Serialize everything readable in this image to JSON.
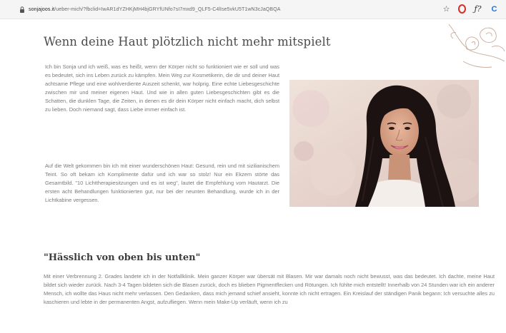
{
  "browser": {
    "url_domain": "sonjajoos.it",
    "url_path": "/ueber-mich/?fbclid=IwAR1dYZHKjMH4bjGRYfUNfo7sI7mxd9_QLF5-C4lIse5vkU5T1wN3cJaQBQA",
    "toolbar_icons": [
      "star-icon",
      "opera-icon",
      "fx-icon",
      "extension-icon"
    ]
  },
  "main": {
    "heading": "Wenn deine Haut plötzlich nicht mehr mitspielt",
    "paragraph1": "Ich bin Sonja und ich weiß, was es heißt, wenn der Körper nicht so funktioniert wie er soll und was es bedeutet, sich ins Leben zurück zu kämpfen. Mein Weg zur Kosmetikerin, die dir und deiner Haut achtsame Pflege und eine wohlverdiente Auszeit schenkt, war holprig. Eine echte Liebesgeschichte zwischen mir und meiner eigenen Haut. Und wie in allen guten Liebesgeschichten gibt es die Schatten, die dunklen Tage, die Zeiten, in denen es dir dein Körper nicht einfach macht, dich selbst zu lieben. Doch niemand sagt, dass Liebe immer einfach ist.",
    "paragraph2": "Auf die Welt gekommen bin ich mit einer wunderschönen Haut: Gesund, rein und mit sizilianischem Teint. So oft bekam ich Komplimente dafür und ich war so stolz! Nur ein Ekzem störte das Gesamtbild. \"10 Lichttherapiesitzungen und es ist weg\", lautet die Empfehlung vom Hautarzt. Die ersten acht Behandlungen funktionierten gut, nur bei der neunten Behandlung, wurde ich in der Lichtkabine vergessen.",
    "subheading": "\"Hässlich von oben bis unten\"",
    "paragraph3": "Mit einer Verbrennung 2. Grades landete ich in der Notfallklinik. Mein ganzer Körper war übersät mit Blasen. Mir war damals noch nicht bewusst, was das bedeutet. Ich dachte, meine Haut bildet sich wieder zurück. Nach 3-4 Tagen bildeten sich die Blasen zurück, doch es blieben Pigmentflecken und Rötungen. Ich fühlte mich entstellt! Innerhalb von 24 Stunden war ich ein anderer Mensch, ich wollte das Haus nicht mehr verlassen. Den Gedanken, dass mich jemand schief ansieht, konnte ich nicht ertragen. Ein Kreislauf der ständigen Panik begann: Ich versuchte alles zu kaschieren und lebte in der permanenten Angst, aufzufliegen. Wenn mein Make-Up verläuft, wenn ich zu"
  },
  "colors": {
    "heading": "#4b4b4b",
    "body_text": "#7a7a7a",
    "floral_line": "#c9a99a",
    "portrait_bg": "#e9d9d3",
    "hair": "#1b1211"
  }
}
